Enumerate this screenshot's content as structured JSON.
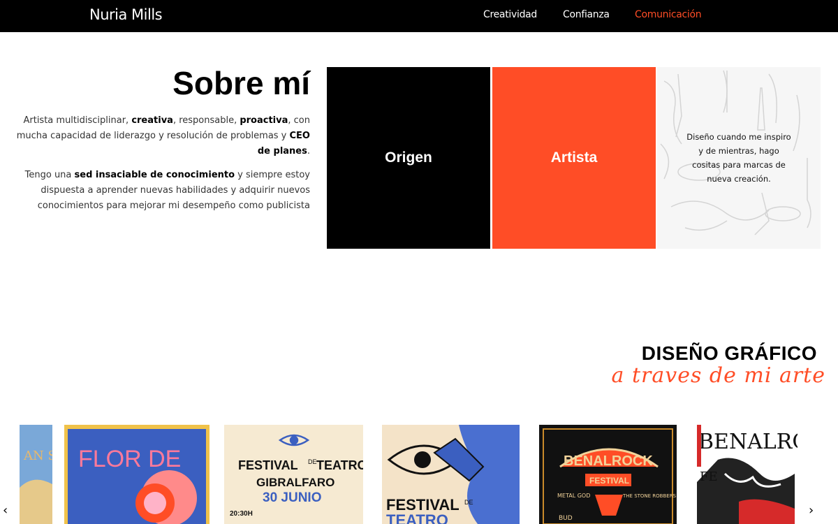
{
  "header": {
    "brand": "Nuria Mills",
    "nav": [
      {
        "label": "Creatividad",
        "active": false
      },
      {
        "label": "Confianza",
        "active": false
      },
      {
        "label": "Comunicación",
        "active": true
      }
    ]
  },
  "about": {
    "title": "Sobre mí",
    "paragraph1": {
      "t1": "Artista multidisciplinar, ",
      "b1": "creativa",
      "t2": ", responsable, ",
      "b2": "proactiva",
      "t3": ", con mucha capacidad de liderazgo y resolución de problemas y ",
      "b3": "CEO de planes",
      "t4": "."
    },
    "paragraph2": {
      "t1": "Tengo una ",
      "b1": "sed insaciable de conocimiento",
      "t2": " y siempre estoy dispuesta a aprender nuevas habilidades y adquirir nuevos conocimientos para mejorar mi desempeño como publicista"
    },
    "cards": [
      {
        "label": "Origen",
        "color": "#000000"
      },
      {
        "label": "Artista",
        "color": "#ff4d26"
      },
      {
        "label": "Diseño cuando me inspiro y de mientras, hago cositas para marcas de nueva creación."
      }
    ]
  },
  "graphic_design": {
    "title": "DISEÑO GRÁFICO",
    "subtitle": "a traves de mi arte"
  },
  "carousel": {
    "posters": [
      {
        "text": "AN SS"
      },
      {
        "text": "FLOR DE"
      },
      {
        "line1": "FESTIVAL",
        "line1b": "DE",
        "line1c": "TEATRO",
        "line2": "GIBRALFARO",
        "line3": "30 JUNIO",
        "line4": "20:30H"
      },
      {
        "line1": "FESTIVAL",
        "line1b": "DE",
        "line2": "TEATRO"
      },
      {
        "line1": "BENALROCK",
        "line2": "FESTIVAL",
        "line3": "METAL GOD",
        "line4": "THE STONE ROBBERS",
        "line5": "BUD"
      },
      {
        "line1": "BENALRO",
        "line2": "FE"
      }
    ],
    "prev_icon": "chevron-left-icon",
    "next_icon": "chevron-right-icon"
  },
  "colors": {
    "accent": "#ff4d26",
    "dark": "#000000",
    "poster_blue": "#3b5fc0",
    "poster_cream": "#f6ead2"
  }
}
